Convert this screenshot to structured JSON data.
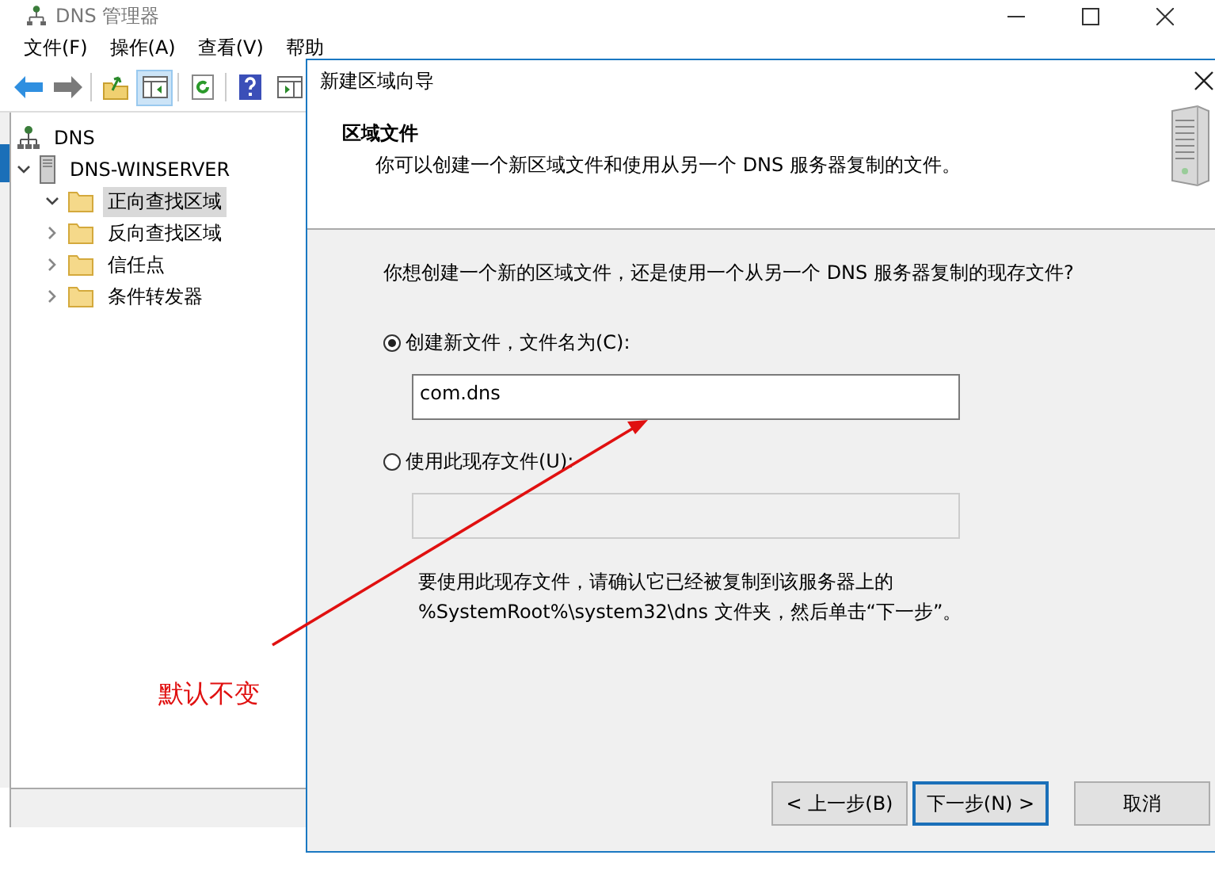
{
  "window": {
    "title": "DNS 管理器"
  },
  "menu": [
    {
      "label": "文件(F)"
    },
    {
      "label": "操作(A)"
    },
    {
      "label": "查看(V)"
    },
    {
      "label": "帮助"
    }
  ],
  "toolbar": [
    {
      "kind": "back",
      "pressed": false
    },
    {
      "kind": "forward",
      "pressed": false
    },
    {
      "kind": "up",
      "pressed": false
    },
    {
      "kind": "tree",
      "pressed": true
    },
    {
      "kind": "refresh",
      "pressed": false
    },
    {
      "kind": "help",
      "pressed": false
    },
    {
      "kind": "panel",
      "pressed": false
    }
  ],
  "tree": [
    {
      "label": "DNS",
      "kind": "dns",
      "children": [
        {
          "label": "DNS-WINSERVER",
          "kind": "server",
          "expanded": true,
          "selected": false,
          "children": [
            {
              "label": "正向查找区域",
              "kind": "folder",
              "expanded": true,
              "selected": true
            },
            {
              "label": "反向查找区域",
              "kind": "folder",
              "expanded": false,
              "selected": false
            },
            {
              "label": "信任点",
              "kind": "folder",
              "expanded": false,
              "selected": false
            },
            {
              "label": "条件转发器",
              "kind": "folder",
              "expanded": false,
              "selected": false
            }
          ]
        }
      ]
    }
  ],
  "dialog": {
    "title": "新建区域向导",
    "heading": "区域文件",
    "subtitle": "你可以创建一个新区域文件和使用从另一个 DNS 服务器复制的文件。",
    "question": "你想创建一个新的区域文件，还是使用一个从另一个 DNS 服务器复制的现存文件?",
    "options": [
      {
        "label": "创建新文件，文件名为(C):",
        "selected": true,
        "value": "com.dns",
        "disabled": false
      },
      {
        "label": "使用此现存文件(U):",
        "selected": false,
        "disabled": true
      }
    ],
    "note_lines": [
      "要使用此现存文件，请确认它已经被复制到该服务器上的",
      "%SystemRoot%\\system32\\dns 文件夹，然后单击“下一步”。"
    ],
    "buttons": [
      {
        "label": "< 上一步(B)",
        "default": false
      },
      {
        "label": "下一步(N) >",
        "default": true
      },
      {
        "label": "取消",
        "default": false
      }
    ]
  },
  "annotation": {
    "text": "默认不变"
  }
}
